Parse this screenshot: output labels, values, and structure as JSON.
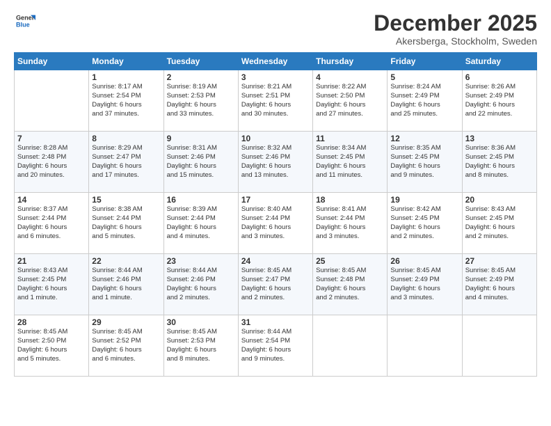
{
  "header": {
    "logo_line1": "General",
    "logo_line2": "Blue",
    "month": "December 2025",
    "location": "Akersberga, Stockholm, Sweden"
  },
  "days_of_week": [
    "Sunday",
    "Monday",
    "Tuesday",
    "Wednesday",
    "Thursday",
    "Friday",
    "Saturday"
  ],
  "weeks": [
    [
      {
        "day": "",
        "info": ""
      },
      {
        "day": "1",
        "info": "Sunrise: 8:17 AM\nSunset: 2:54 PM\nDaylight: 6 hours\nand 37 minutes."
      },
      {
        "day": "2",
        "info": "Sunrise: 8:19 AM\nSunset: 2:53 PM\nDaylight: 6 hours\nand 33 minutes."
      },
      {
        "day": "3",
        "info": "Sunrise: 8:21 AM\nSunset: 2:51 PM\nDaylight: 6 hours\nand 30 minutes."
      },
      {
        "day": "4",
        "info": "Sunrise: 8:22 AM\nSunset: 2:50 PM\nDaylight: 6 hours\nand 27 minutes."
      },
      {
        "day": "5",
        "info": "Sunrise: 8:24 AM\nSunset: 2:49 PM\nDaylight: 6 hours\nand 25 minutes."
      },
      {
        "day": "6",
        "info": "Sunrise: 8:26 AM\nSunset: 2:49 PM\nDaylight: 6 hours\nand 22 minutes."
      }
    ],
    [
      {
        "day": "7",
        "info": "Sunrise: 8:28 AM\nSunset: 2:48 PM\nDaylight: 6 hours\nand 20 minutes."
      },
      {
        "day": "8",
        "info": "Sunrise: 8:29 AM\nSunset: 2:47 PM\nDaylight: 6 hours\nand 17 minutes."
      },
      {
        "day": "9",
        "info": "Sunrise: 8:31 AM\nSunset: 2:46 PM\nDaylight: 6 hours\nand 15 minutes."
      },
      {
        "day": "10",
        "info": "Sunrise: 8:32 AM\nSunset: 2:46 PM\nDaylight: 6 hours\nand 13 minutes."
      },
      {
        "day": "11",
        "info": "Sunrise: 8:34 AM\nSunset: 2:45 PM\nDaylight: 6 hours\nand 11 minutes."
      },
      {
        "day": "12",
        "info": "Sunrise: 8:35 AM\nSunset: 2:45 PM\nDaylight: 6 hours\nand 9 minutes."
      },
      {
        "day": "13",
        "info": "Sunrise: 8:36 AM\nSunset: 2:45 PM\nDaylight: 6 hours\nand 8 minutes."
      }
    ],
    [
      {
        "day": "14",
        "info": "Sunrise: 8:37 AM\nSunset: 2:44 PM\nDaylight: 6 hours\nand 6 minutes."
      },
      {
        "day": "15",
        "info": "Sunrise: 8:38 AM\nSunset: 2:44 PM\nDaylight: 6 hours\nand 5 minutes."
      },
      {
        "day": "16",
        "info": "Sunrise: 8:39 AM\nSunset: 2:44 PM\nDaylight: 6 hours\nand 4 minutes."
      },
      {
        "day": "17",
        "info": "Sunrise: 8:40 AM\nSunset: 2:44 PM\nDaylight: 6 hours\nand 3 minutes."
      },
      {
        "day": "18",
        "info": "Sunrise: 8:41 AM\nSunset: 2:44 PM\nDaylight: 6 hours\nand 3 minutes."
      },
      {
        "day": "19",
        "info": "Sunrise: 8:42 AM\nSunset: 2:45 PM\nDaylight: 6 hours\nand 2 minutes."
      },
      {
        "day": "20",
        "info": "Sunrise: 8:43 AM\nSunset: 2:45 PM\nDaylight: 6 hours\nand 2 minutes."
      }
    ],
    [
      {
        "day": "21",
        "info": "Sunrise: 8:43 AM\nSunset: 2:45 PM\nDaylight: 6 hours\nand 1 minute."
      },
      {
        "day": "22",
        "info": "Sunrise: 8:44 AM\nSunset: 2:46 PM\nDaylight: 6 hours\nand 1 minute."
      },
      {
        "day": "23",
        "info": "Sunrise: 8:44 AM\nSunset: 2:46 PM\nDaylight: 6 hours\nand 2 minutes."
      },
      {
        "day": "24",
        "info": "Sunrise: 8:45 AM\nSunset: 2:47 PM\nDaylight: 6 hours\nand 2 minutes."
      },
      {
        "day": "25",
        "info": "Sunrise: 8:45 AM\nSunset: 2:48 PM\nDaylight: 6 hours\nand 2 minutes."
      },
      {
        "day": "26",
        "info": "Sunrise: 8:45 AM\nSunset: 2:49 PM\nDaylight: 6 hours\nand 3 minutes."
      },
      {
        "day": "27",
        "info": "Sunrise: 8:45 AM\nSunset: 2:49 PM\nDaylight: 6 hours\nand 4 minutes."
      }
    ],
    [
      {
        "day": "28",
        "info": "Sunrise: 8:45 AM\nSunset: 2:50 PM\nDaylight: 6 hours\nand 5 minutes."
      },
      {
        "day": "29",
        "info": "Sunrise: 8:45 AM\nSunset: 2:52 PM\nDaylight: 6 hours\nand 6 minutes."
      },
      {
        "day": "30",
        "info": "Sunrise: 8:45 AM\nSunset: 2:53 PM\nDaylight: 6 hours\nand 8 minutes."
      },
      {
        "day": "31",
        "info": "Sunrise: 8:44 AM\nSunset: 2:54 PM\nDaylight: 6 hours\nand 9 minutes."
      },
      {
        "day": "",
        "info": ""
      },
      {
        "day": "",
        "info": ""
      },
      {
        "day": "",
        "info": ""
      }
    ]
  ]
}
